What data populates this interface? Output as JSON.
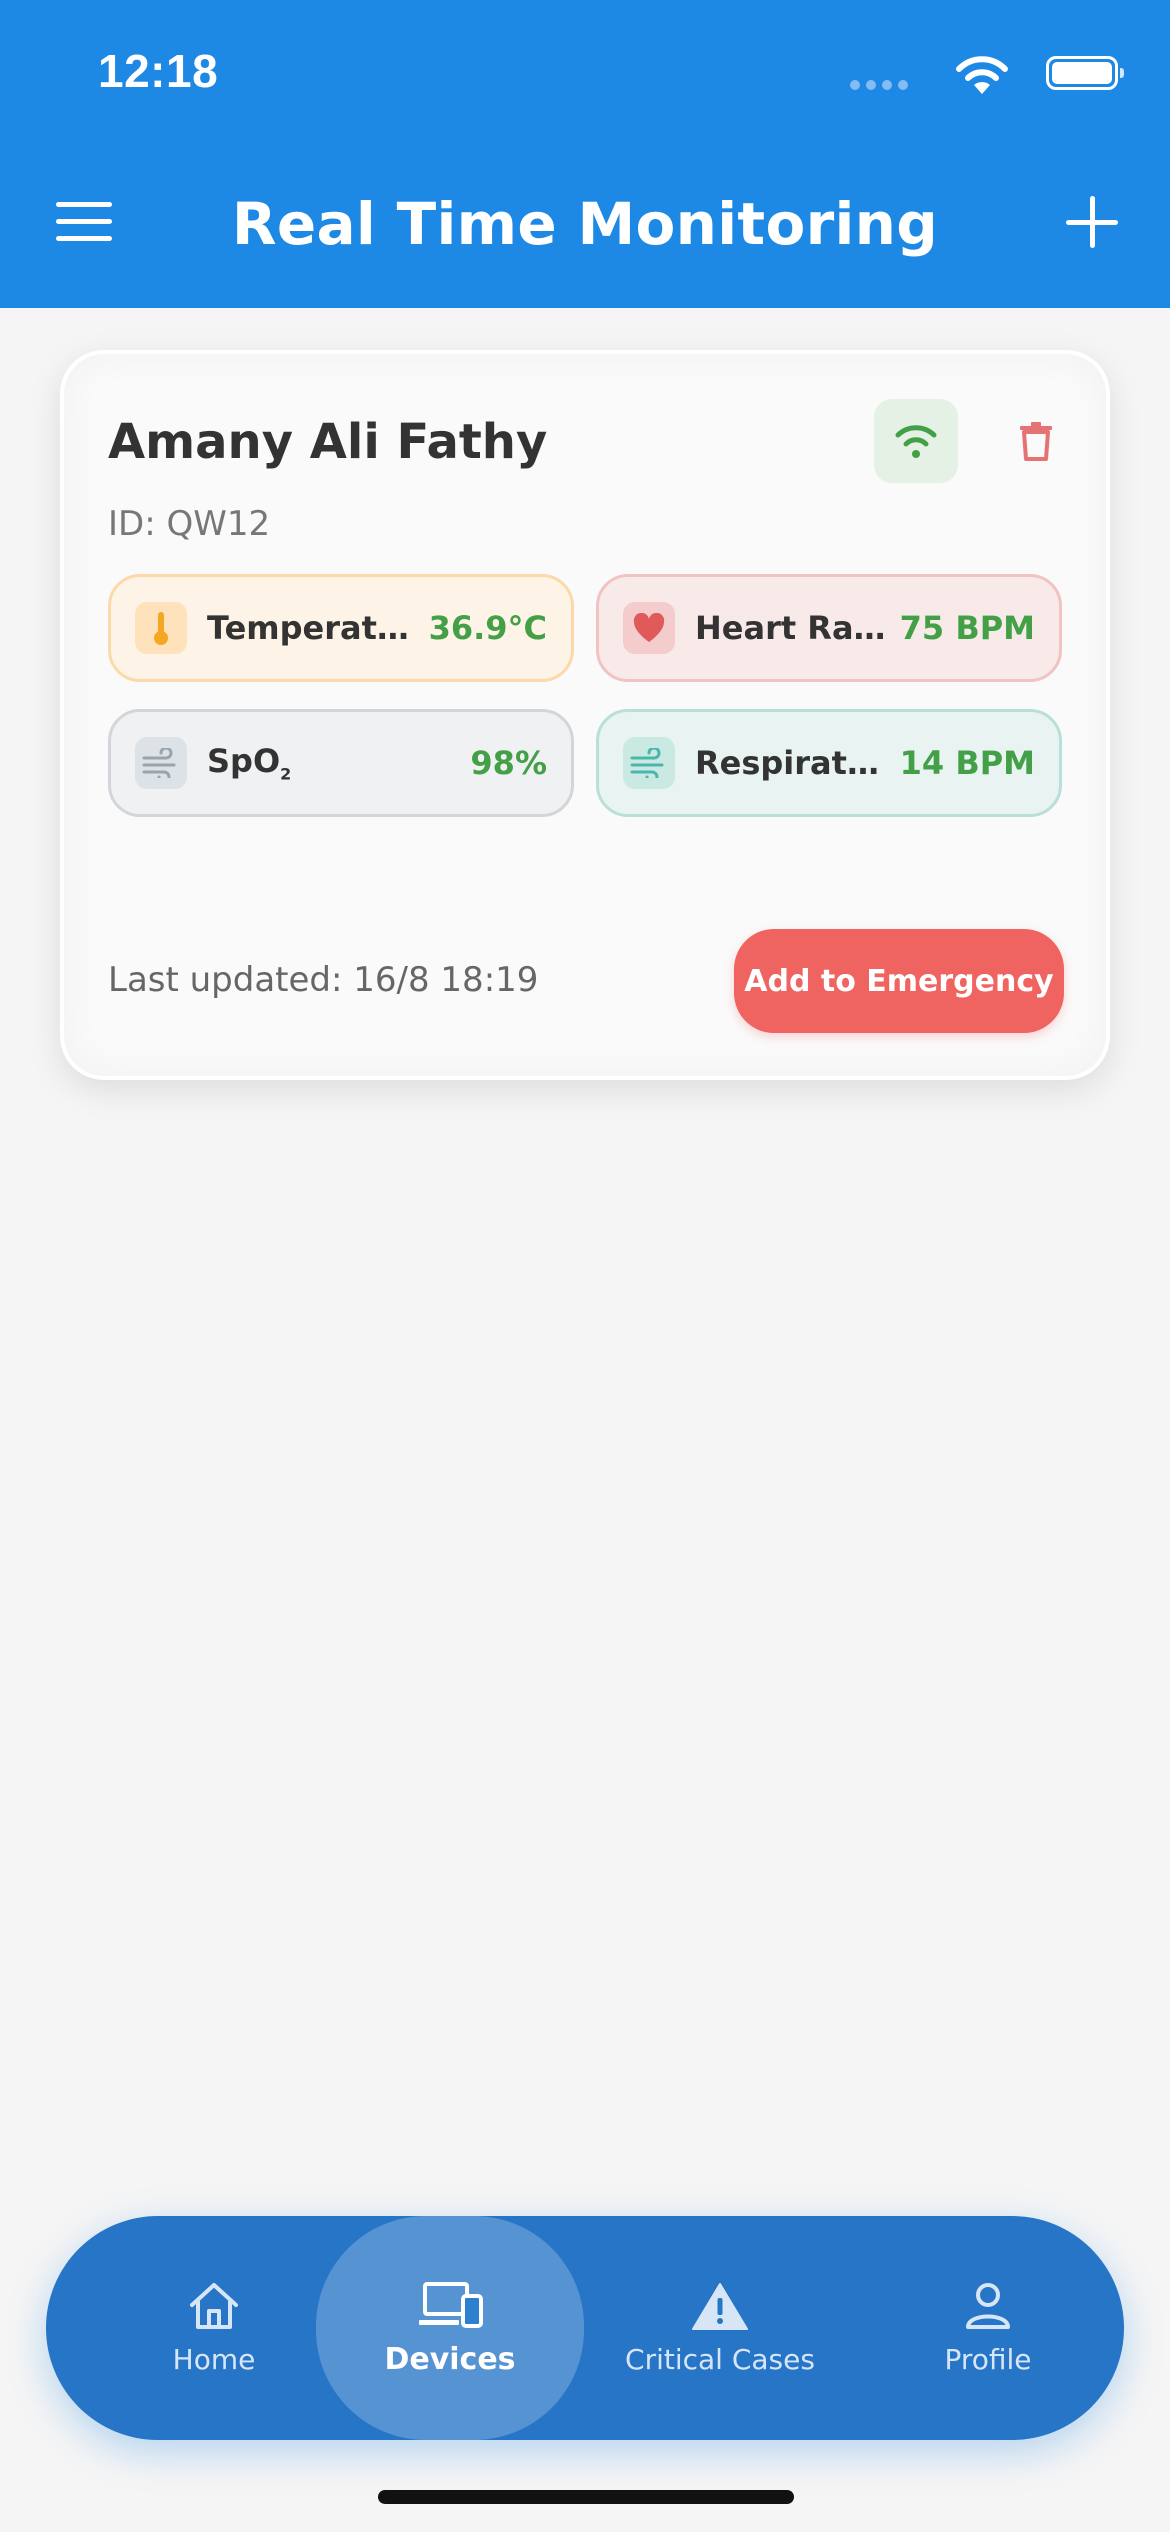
{
  "status_bar": {
    "time": "12:18"
  },
  "header": {
    "title": "Real Time Monitoring"
  },
  "card": {
    "name": "Amany Ali Fathy",
    "id": "ID: QW12",
    "metrics": {
      "temperature": {
        "label": "Temperature",
        "value": "36.9°C"
      },
      "heart_rate": {
        "label": "Heart Rate",
        "value": "75 BPM"
      },
      "spo2": {
        "label": "SpO",
        "sub": "2",
        "value": "98%"
      },
      "respiratory": {
        "label": "Respiratory Rate",
        "value": "14 BPM"
      }
    },
    "last_updated": "Last updated: 16/8 18:19",
    "emergency_label": "Add to Emergency"
  },
  "nav": {
    "items": [
      {
        "label": "Home",
        "icon": "home-icon"
      },
      {
        "label": "Devices",
        "icon": "devices-icon"
      },
      {
        "label": "Critical Cases",
        "icon": "warning-icon"
      },
      {
        "label": "Profile",
        "icon": "person-icon"
      }
    ],
    "active": "Devices"
  },
  "colors": {
    "primary": "#1e88e5",
    "nav_bg": "#2775c6",
    "value_green": "#43a047",
    "emergency_red": "#ef6461"
  }
}
